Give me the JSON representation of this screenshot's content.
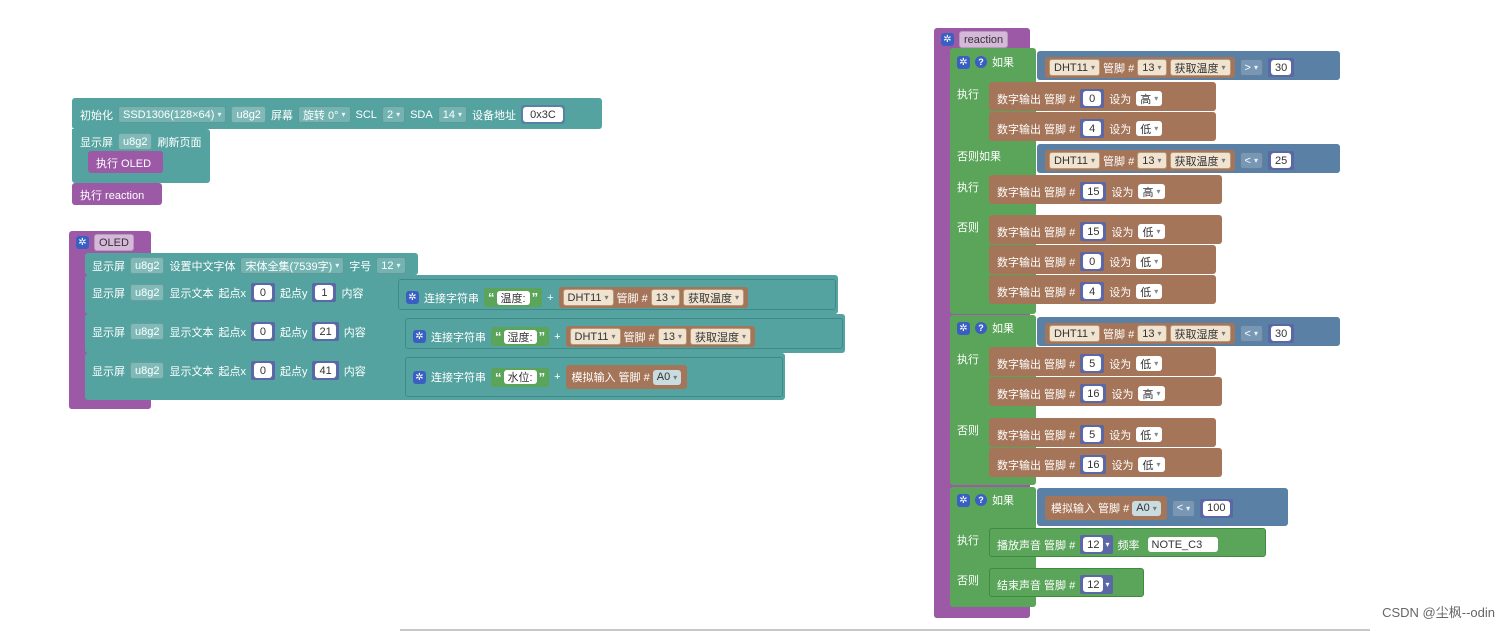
{
  "init_block": {
    "label": "初始化",
    "display": "SSD1306(128×64)",
    "lib": "u8g2",
    "screen_label": "屏幕",
    "rotation": "旋转 0°",
    "scl_label": "SCL",
    "scl": "2",
    "sda_label": "SDA",
    "sda": "14",
    "addr_label": "设备地址",
    "addr": "0x3C",
    "refresh_label": "显示屏",
    "refresh_lib": "u8g2",
    "refresh_text": "刷新页面",
    "exec_oled": "执行  OLED",
    "exec_reaction": "执行  reaction"
  },
  "oled_func": {
    "name": "OLED",
    "font_row": {
      "display": "显示屏",
      "lib": "u8g2",
      "set_font": "设置中文字体",
      "font": "宋体全集(7539字)",
      "size_label": "字号",
      "size": "12"
    },
    "rows": [
      {
        "display": "显示屏",
        "lib": "u8g2",
        "show_text": "显示文本",
        "x_label": "起点x",
        "x": "0",
        "y_label": "起点y",
        "y": "1",
        "content_label": "内容",
        "concat": "连接字符串",
        "str": "温度:",
        "plus": "+",
        "sensor": "DHT11",
        "pin_label": "管脚 #",
        "pin": "13",
        "op": "获取温度"
      },
      {
        "display": "显示屏",
        "lib": "u8g2",
        "show_text": "显示文本",
        "x_label": "起点x",
        "x": "0",
        "y_label": "起点y",
        "y": "21",
        "content_label": "内容",
        "concat": "连接字符串",
        "str": "湿度:",
        "plus": "+",
        "sensor": "DHT11",
        "pin_label": "管脚 #",
        "pin": "13",
        "op": "获取湿度"
      },
      {
        "display": "显示屏",
        "lib": "u8g2",
        "show_text": "显示文本",
        "x_label": "起点x",
        "x": "0",
        "y_label": "起点y",
        "y": "41",
        "content_label": "内容",
        "concat": "连接字符串",
        "str": "水位:",
        "plus": "+",
        "analog": "模拟输入 管脚 #",
        "apin": "A0"
      }
    ]
  },
  "reaction_func": {
    "name": "reaction",
    "if_label": "如果",
    "exec_label": "执行",
    "elseif_label": "否则如果",
    "else_label": "否则",
    "dout_label": "数字输出 管脚 #",
    "set_label": "设为",
    "sensor": "DHT11",
    "pin_label": "管脚 #",
    "op_temp": "获取温度",
    "op_hum": "获取湿度",
    "if1": {
      "pin": "13",
      "op": ">",
      "val": "30"
    },
    "if1_do": [
      {
        "pin": "0",
        "v": "高"
      },
      {
        "pin": "4",
        "v": "低"
      }
    ],
    "elif1": {
      "pin": "13",
      "op": "<",
      "val": "25"
    },
    "elif1_do": [
      {
        "pin": "15",
        "v": "高"
      }
    ],
    "else1_do": [
      {
        "pin": "15",
        "v": "低"
      },
      {
        "pin": "0",
        "v": "低"
      },
      {
        "pin": "4",
        "v": "低"
      }
    ],
    "if2": {
      "pin": "13",
      "op": "<",
      "val": "30"
    },
    "if2_do": [
      {
        "pin": "5",
        "v": "低"
      },
      {
        "pin": "16",
        "v": "高"
      }
    ],
    "else2_do": [
      {
        "pin": "5",
        "v": "低"
      },
      {
        "pin": "16",
        "v": "低"
      }
    ],
    "if3": {
      "analog": "模拟输入 管脚 #",
      "apin": "A0",
      "op": "<",
      "val": "100"
    },
    "play": {
      "label": "播放声音  管脚 #",
      "pin": "12",
      "freq_label": "频率",
      "note": "NOTE_C3"
    },
    "stop": {
      "label": "结束声音  管脚 #",
      "pin": "12"
    }
  },
  "watermark": "CSDN @尘枫--odin"
}
